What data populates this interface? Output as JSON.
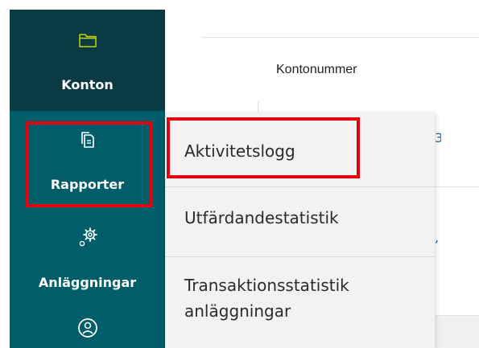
{
  "sidebar": {
    "items": [
      {
        "label": "Konton",
        "icon": "folder-icon"
      },
      {
        "label": "Rapporter",
        "icon": "report-document-icon"
      },
      {
        "label": "Anläggningar",
        "icon": "gears-icon"
      },
      {
        "label": "",
        "icon": "user-circle-icon"
      }
    ]
  },
  "table": {
    "header": "Kontonummer",
    "row_fragments": [
      "3",
      ","
    ]
  },
  "dropdown": {
    "items": [
      {
        "label": "Aktivitetslogg"
      },
      {
        "label": "Utfärdandestatistik"
      },
      {
        "label_line1": "Transaktionsstatistik",
        "label_line2": "anläggningar"
      }
    ]
  },
  "colors": {
    "sidebar_bg": "#005d69",
    "sidebar_active_bg": "#0a3b44",
    "icon_active": "#c4d600",
    "highlight": "#e3000f",
    "dropdown_bg": "#f2f2f2",
    "link": "#1e6fa3"
  }
}
